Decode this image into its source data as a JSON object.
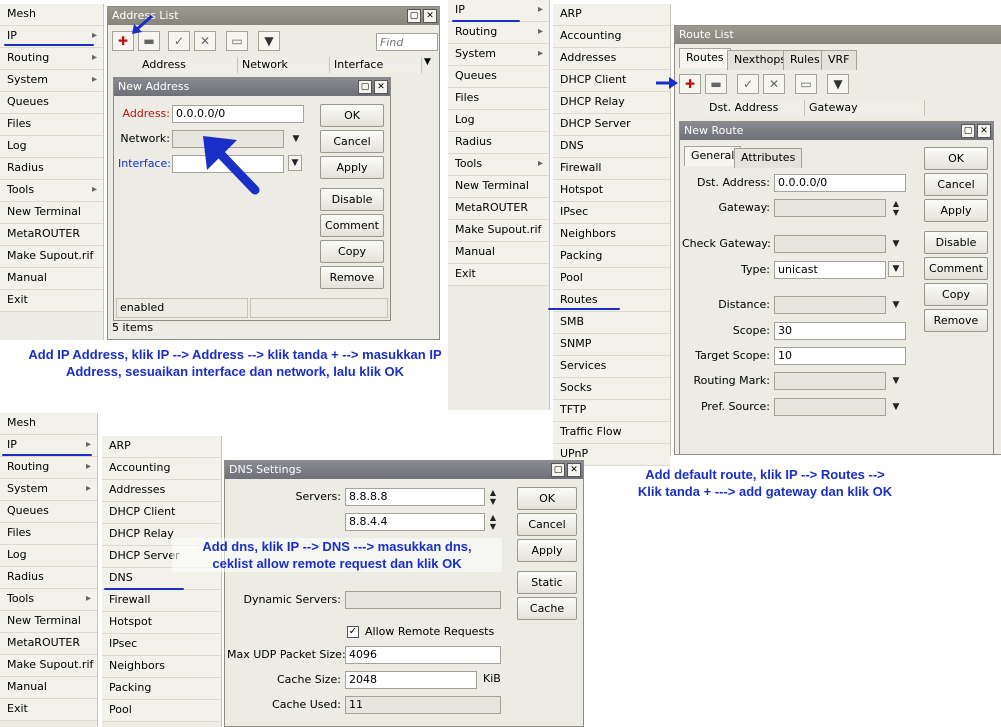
{
  "menu_tl": [
    {
      "label": "Mesh"
    },
    {
      "label": "IP",
      "arrow": true
    },
    {
      "label": "Routing",
      "arrow": true
    },
    {
      "label": "System",
      "arrow": true
    },
    {
      "label": "Queues"
    },
    {
      "label": "Files"
    },
    {
      "label": "Log"
    },
    {
      "label": "Radius"
    },
    {
      "label": "Tools",
      "arrow": true
    },
    {
      "label": "New Terminal"
    },
    {
      "label": "MetaROUTER"
    },
    {
      "label": "Make Supout.rif"
    },
    {
      "label": "Manual"
    },
    {
      "label": "Exit"
    }
  ],
  "menu_bl": [
    {
      "label": "Mesh"
    },
    {
      "label": "IP",
      "arrow": true
    },
    {
      "label": "Routing",
      "arrow": true
    },
    {
      "label": "System",
      "arrow": true
    },
    {
      "label": "Queues"
    },
    {
      "label": "Files"
    },
    {
      "label": "Log"
    },
    {
      "label": "Radius"
    },
    {
      "label": "Tools",
      "arrow": true
    },
    {
      "label": "New Terminal"
    },
    {
      "label": "MetaROUTER"
    },
    {
      "label": "Make Supout.rif"
    },
    {
      "label": "Manual"
    },
    {
      "label": "Exit"
    }
  ],
  "menu_mid": [
    {
      "label": "IP",
      "arrow": true
    },
    {
      "label": "Routing",
      "arrow": true
    },
    {
      "label": "System",
      "arrow": true
    },
    {
      "label": "Queues"
    },
    {
      "label": "Files"
    },
    {
      "label": "Log"
    },
    {
      "label": "Radius"
    },
    {
      "label": "Tools",
      "arrow": true
    },
    {
      "label": "New Terminal"
    },
    {
      "label": "MetaROUTER"
    },
    {
      "label": "Make Supout.rif"
    },
    {
      "label": "Manual"
    },
    {
      "label": "Exit"
    }
  ],
  "submenu_ip": [
    {
      "label": "ARP"
    },
    {
      "label": "Accounting"
    },
    {
      "label": "Addresses"
    },
    {
      "label": "DHCP Client"
    },
    {
      "label": "DHCP Relay"
    },
    {
      "label": "DHCP Server"
    },
    {
      "label": "DNS"
    },
    {
      "label": "Firewall"
    },
    {
      "label": "Hotspot"
    },
    {
      "label": "IPsec"
    },
    {
      "label": "Neighbors"
    },
    {
      "label": "Packing"
    },
    {
      "label": "Pool"
    },
    {
      "label": "Routes"
    },
    {
      "label": "SMB"
    },
    {
      "label": "SNMP"
    },
    {
      "label": "Services"
    },
    {
      "label": "Socks"
    },
    {
      "label": "TFTP"
    },
    {
      "label": "Traffic Flow"
    },
    {
      "label": "UPnP"
    }
  ],
  "submenu_ip2": [
    {
      "label": "ARP"
    },
    {
      "label": "Accounting"
    },
    {
      "label": "Addresses"
    },
    {
      "label": "DHCP Client"
    },
    {
      "label": "DHCP Relay"
    },
    {
      "label": "DHCP Server"
    },
    {
      "label": "DNS"
    },
    {
      "label": "Firewall"
    },
    {
      "label": "Hotspot"
    },
    {
      "label": "IPsec"
    },
    {
      "label": "Neighbors"
    },
    {
      "label": "Packing"
    },
    {
      "label": "Pool"
    }
  ],
  "address_list": {
    "title": "Address List",
    "find_placeholder": "Find",
    "columns": [
      "Address",
      "Network",
      "Interface"
    ],
    "status": "5 items"
  },
  "new_address": {
    "title": "New Address",
    "address_label": "Address:",
    "address_value": "0.0.0.0/0",
    "network_label": "Network:",
    "interface_label": "Interface:",
    "buttons": [
      "OK",
      "Cancel",
      "Apply",
      "Disable",
      "Comment",
      "Copy",
      "Remove"
    ],
    "status": "enabled"
  },
  "route_list": {
    "title": "Route List",
    "tabs": [
      "Routes",
      "Nexthops",
      "Rules",
      "VRF"
    ],
    "columns": [
      "Dst. Address",
      "Gateway"
    ]
  },
  "new_route": {
    "title": "New Route",
    "tabs": [
      "General",
      "Attributes"
    ],
    "fields": {
      "dst_label": "Dst. Address:",
      "dst_value": "0.0.0.0/0",
      "gateway_label": "Gateway:",
      "check_gateway_label": "Check Gateway:",
      "type_label": "Type:",
      "type_value": "unicast",
      "distance_label": "Distance:",
      "scope_label": "Scope:",
      "scope_value": "30",
      "target_scope_label": "Target Scope:",
      "target_scope_value": "10",
      "routing_mark_label": "Routing Mark:",
      "pref_source_label": "Pref. Source:"
    },
    "buttons": [
      "OK",
      "Cancel",
      "Apply",
      "Disable",
      "Comment",
      "Copy",
      "Remove"
    ]
  },
  "dns_settings": {
    "title": "DNS Settings",
    "servers_label": "Servers:",
    "server1": "8.8.8.8",
    "server2": "8.8.4.4",
    "dynamic_servers_label": "Dynamic Servers:",
    "allow_remote_label": "Allow Remote Requests",
    "max_udp_label": "Max UDP Packet Size:",
    "max_udp_value": "4096",
    "cache_size_label": "Cache Size:",
    "cache_size_value": "2048",
    "cache_size_unit": "KiB",
    "cache_used_label": "Cache Used:",
    "cache_used_value": "11",
    "buttons": [
      "OK",
      "Cancel",
      "Apply",
      "Static",
      "Cache"
    ]
  },
  "annotations": {
    "ip_address_line1": "Add IP Address, klik IP --> Address --> klik tanda + --> masukkan IP",
    "ip_address_line2": "Address, sesuaikan interface dan network, lalu klik OK",
    "dns_line1": "Add dns, klik IP --> DNS ---> masukkan dns,",
    "dns_line2": "ceklist allow remote request dan klik OK",
    "route_line1": "Add default route, klik IP --> Routes -->",
    "route_line2": "Klik tanda + ---> add gateway dan klik OK"
  },
  "colors": {
    "annotation": "#1a2fc8",
    "add_icon": "#c01010",
    "required_label": "#c01010",
    "link_label": "#1030c0"
  }
}
